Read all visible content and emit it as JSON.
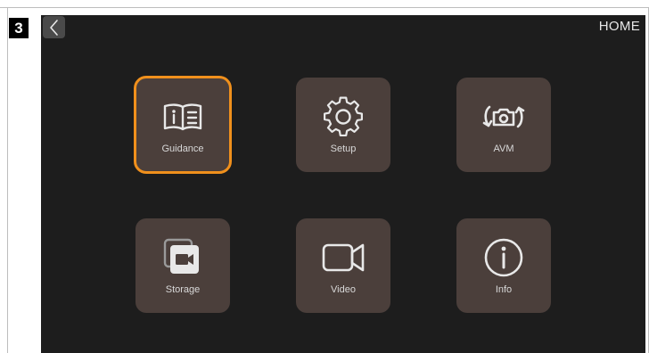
{
  "step_badge": "3",
  "header": {
    "title": "HOME",
    "back_icon": "chevron-left-icon"
  },
  "tiles": [
    {
      "label": "Guidance",
      "icon": "book-icon",
      "selected": true
    },
    {
      "label": "Setup",
      "icon": "gear-icon",
      "selected": false
    },
    {
      "label": "AVM",
      "icon": "camera-rotate-icon",
      "selected": false
    },
    {
      "label": "Storage",
      "icon": "gallery-stack-icon",
      "selected": false
    },
    {
      "label": "Video",
      "icon": "video-camera-icon",
      "selected": false
    },
    {
      "label": "Info",
      "icon": "info-icon",
      "selected": false
    }
  ],
  "colors": {
    "screen_bg": "#1d1d1d",
    "tile_bg": "#4b3f3b",
    "selection_outline": "#f0901c",
    "icon_color": "#e8e8e8"
  }
}
